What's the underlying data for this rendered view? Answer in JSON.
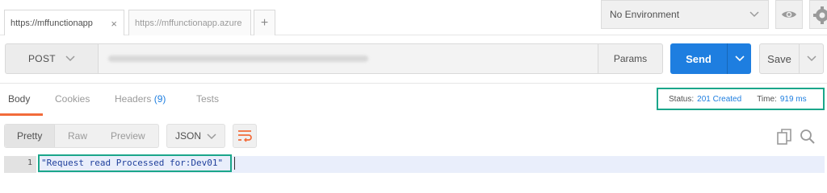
{
  "tabs": [
    {
      "label": "https://mffunctionapp",
      "close": "×",
      "active": true
    },
    {
      "label": "https://mffunctionapp.azure",
      "close": "",
      "active": false
    }
  ],
  "new_tab": "+",
  "environment": {
    "selected": "No Environment"
  },
  "request": {
    "method": "POST",
    "params_label": "Params",
    "send_label": "Send",
    "save_label": "Save"
  },
  "response_tabs": [
    {
      "label": "Body",
      "count": "",
      "active": true
    },
    {
      "label": "Cookies",
      "count": "",
      "active": false
    },
    {
      "label": "Headers",
      "count": "(9)",
      "active": false
    },
    {
      "label": "Tests",
      "count": "",
      "active": false
    }
  ],
  "status": {
    "status_label": "Status:",
    "status_value": "201 Created",
    "time_label": "Time:",
    "time_value": "919 ms"
  },
  "view_modes": [
    "Pretty",
    "Raw",
    "Preview"
  ],
  "format": "JSON",
  "code": {
    "line_number": "1",
    "text": "\"Request read Processed for:Dev01\""
  },
  "colors": {
    "accent_blue": "#1e7ee0",
    "active_orange": "#f26b3a",
    "highlight_green": "#1aa68a"
  }
}
